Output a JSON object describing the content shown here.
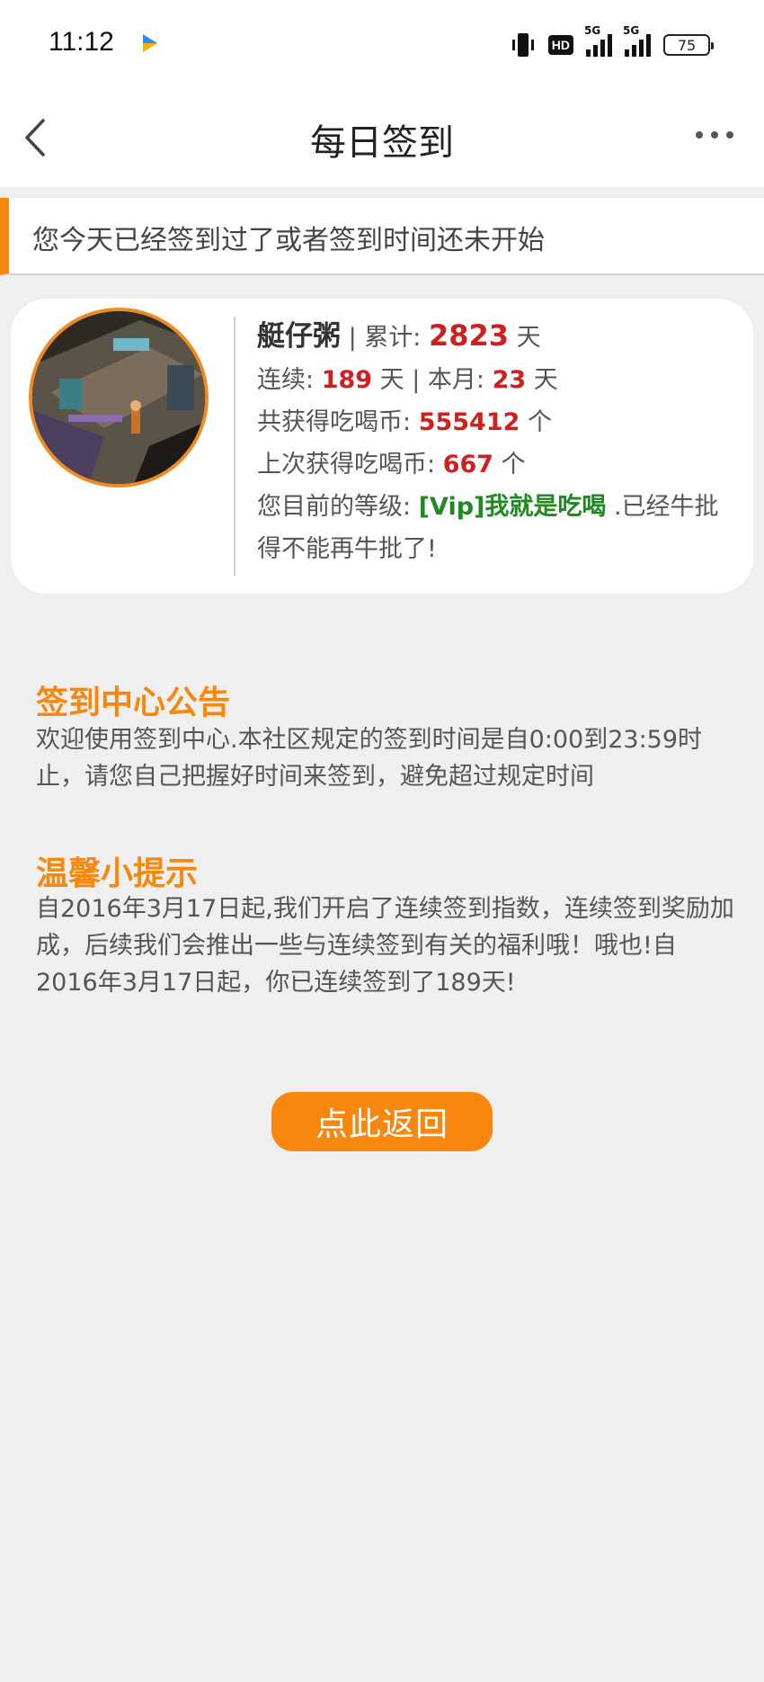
{
  "status": {
    "time": "11:12",
    "hd": "HD",
    "net1": "5G",
    "net2": "5G",
    "battery": "75"
  },
  "nav": {
    "title": "每日签到"
  },
  "notice": "您今天已经签到过了或者签到时间还未开始",
  "profile": {
    "username": "艇仔粥",
    "sep1": " | ",
    "total_label": "累计: ",
    "total_days": "2823",
    "day_unit": " 天",
    "streak_label": "连续: ",
    "streak_days": "189",
    "sep2": " 天 | ",
    "month_label": "本月: ",
    "month_days": "23",
    "coins_label": "共获得吃喝币: ",
    "coins_total": "555412",
    "coin_unit": " 个",
    "last_label": "上次获得吃喝币: ",
    "last_coins": "667",
    "level_label": "您目前的等级: ",
    "level_name": "[Vip]我就是吃喝",
    "level_suffix": " .已经牛批得不能再牛批了!"
  },
  "announcement": {
    "title": "签到中心公告",
    "body": "欢迎使用签到中心.本社区规定的签到时间是自0:00到23:59时止，请您自己把握好时间来签到，避免超过规定时间"
  },
  "tips": {
    "title": "温馨小提示",
    "body": "自2016年3月17日起,我们开启了连续签到指数，连续签到奖励加成，后续我们会推出一些与连续签到有关的福利哦！哦也!自2016年3月17日起，你已连续签到了189天!"
  },
  "back_button": "点此返回",
  "colors": {
    "accent": "#f7870e",
    "number": "#d01f1f",
    "level": "#1f8a1f"
  }
}
